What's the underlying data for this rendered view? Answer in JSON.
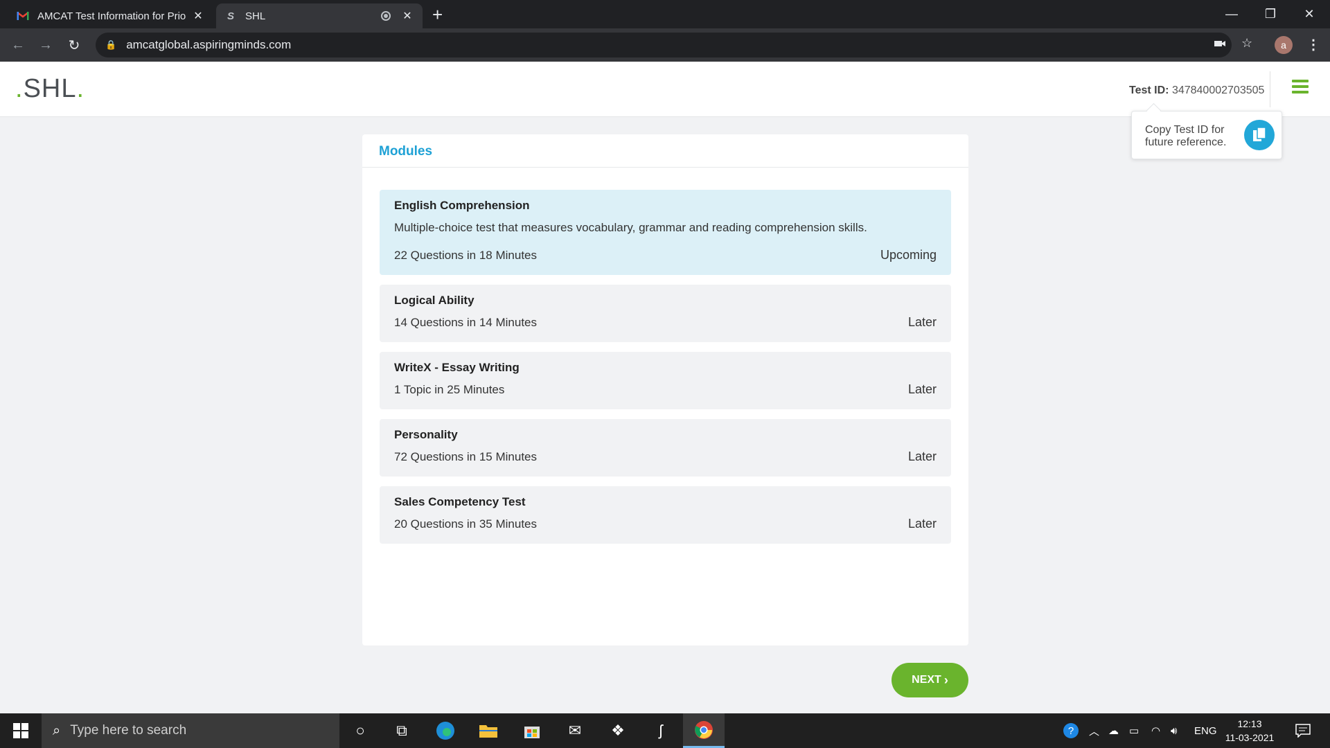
{
  "browser": {
    "tabs": [
      {
        "title": "AMCAT Test Information for Prio",
        "favicon": "gmail-icon"
      },
      {
        "title": "SHL",
        "favicon": "shl-icon"
      }
    ],
    "url": "amcatglobal.aspiringminds.com",
    "profile_initial": "a"
  },
  "header": {
    "logo_text": ".SHL.",
    "test_id_label": "Test ID:",
    "test_id_value": "347840002703505",
    "tooltip_text": "Copy Test ID for future reference.",
    "accent": "#6ab42d"
  },
  "modules_card": {
    "title": "Modules",
    "title_color": "#1ea1d5",
    "items": [
      {
        "name": "English Comprehension",
        "description": "Multiple-choice test that measures vocabulary, grammar and reading comprehension skills.",
        "count": "22 Questions in 18 Minutes",
        "status": "Upcoming"
      },
      {
        "name": "Logical Ability",
        "description": "",
        "count": "14 Questions in 14 Minutes",
        "status": "Later"
      },
      {
        "name": "WriteX - Essay Writing",
        "description": "",
        "count": "1 Topic in 25 Minutes",
        "status": "Later"
      },
      {
        "name": "Personality",
        "description": "",
        "count": "72 Questions in 15 Minutes",
        "status": "Later"
      },
      {
        "name": "Sales Competency Test",
        "description": "",
        "count": "20 Questions in 35 Minutes",
        "status": "Later"
      }
    ]
  },
  "next_button": {
    "label": "NEXT"
  },
  "taskbar": {
    "search_placeholder": "Type here to search",
    "language": "ENG",
    "time": "12:13",
    "date": "11-03-2021"
  }
}
